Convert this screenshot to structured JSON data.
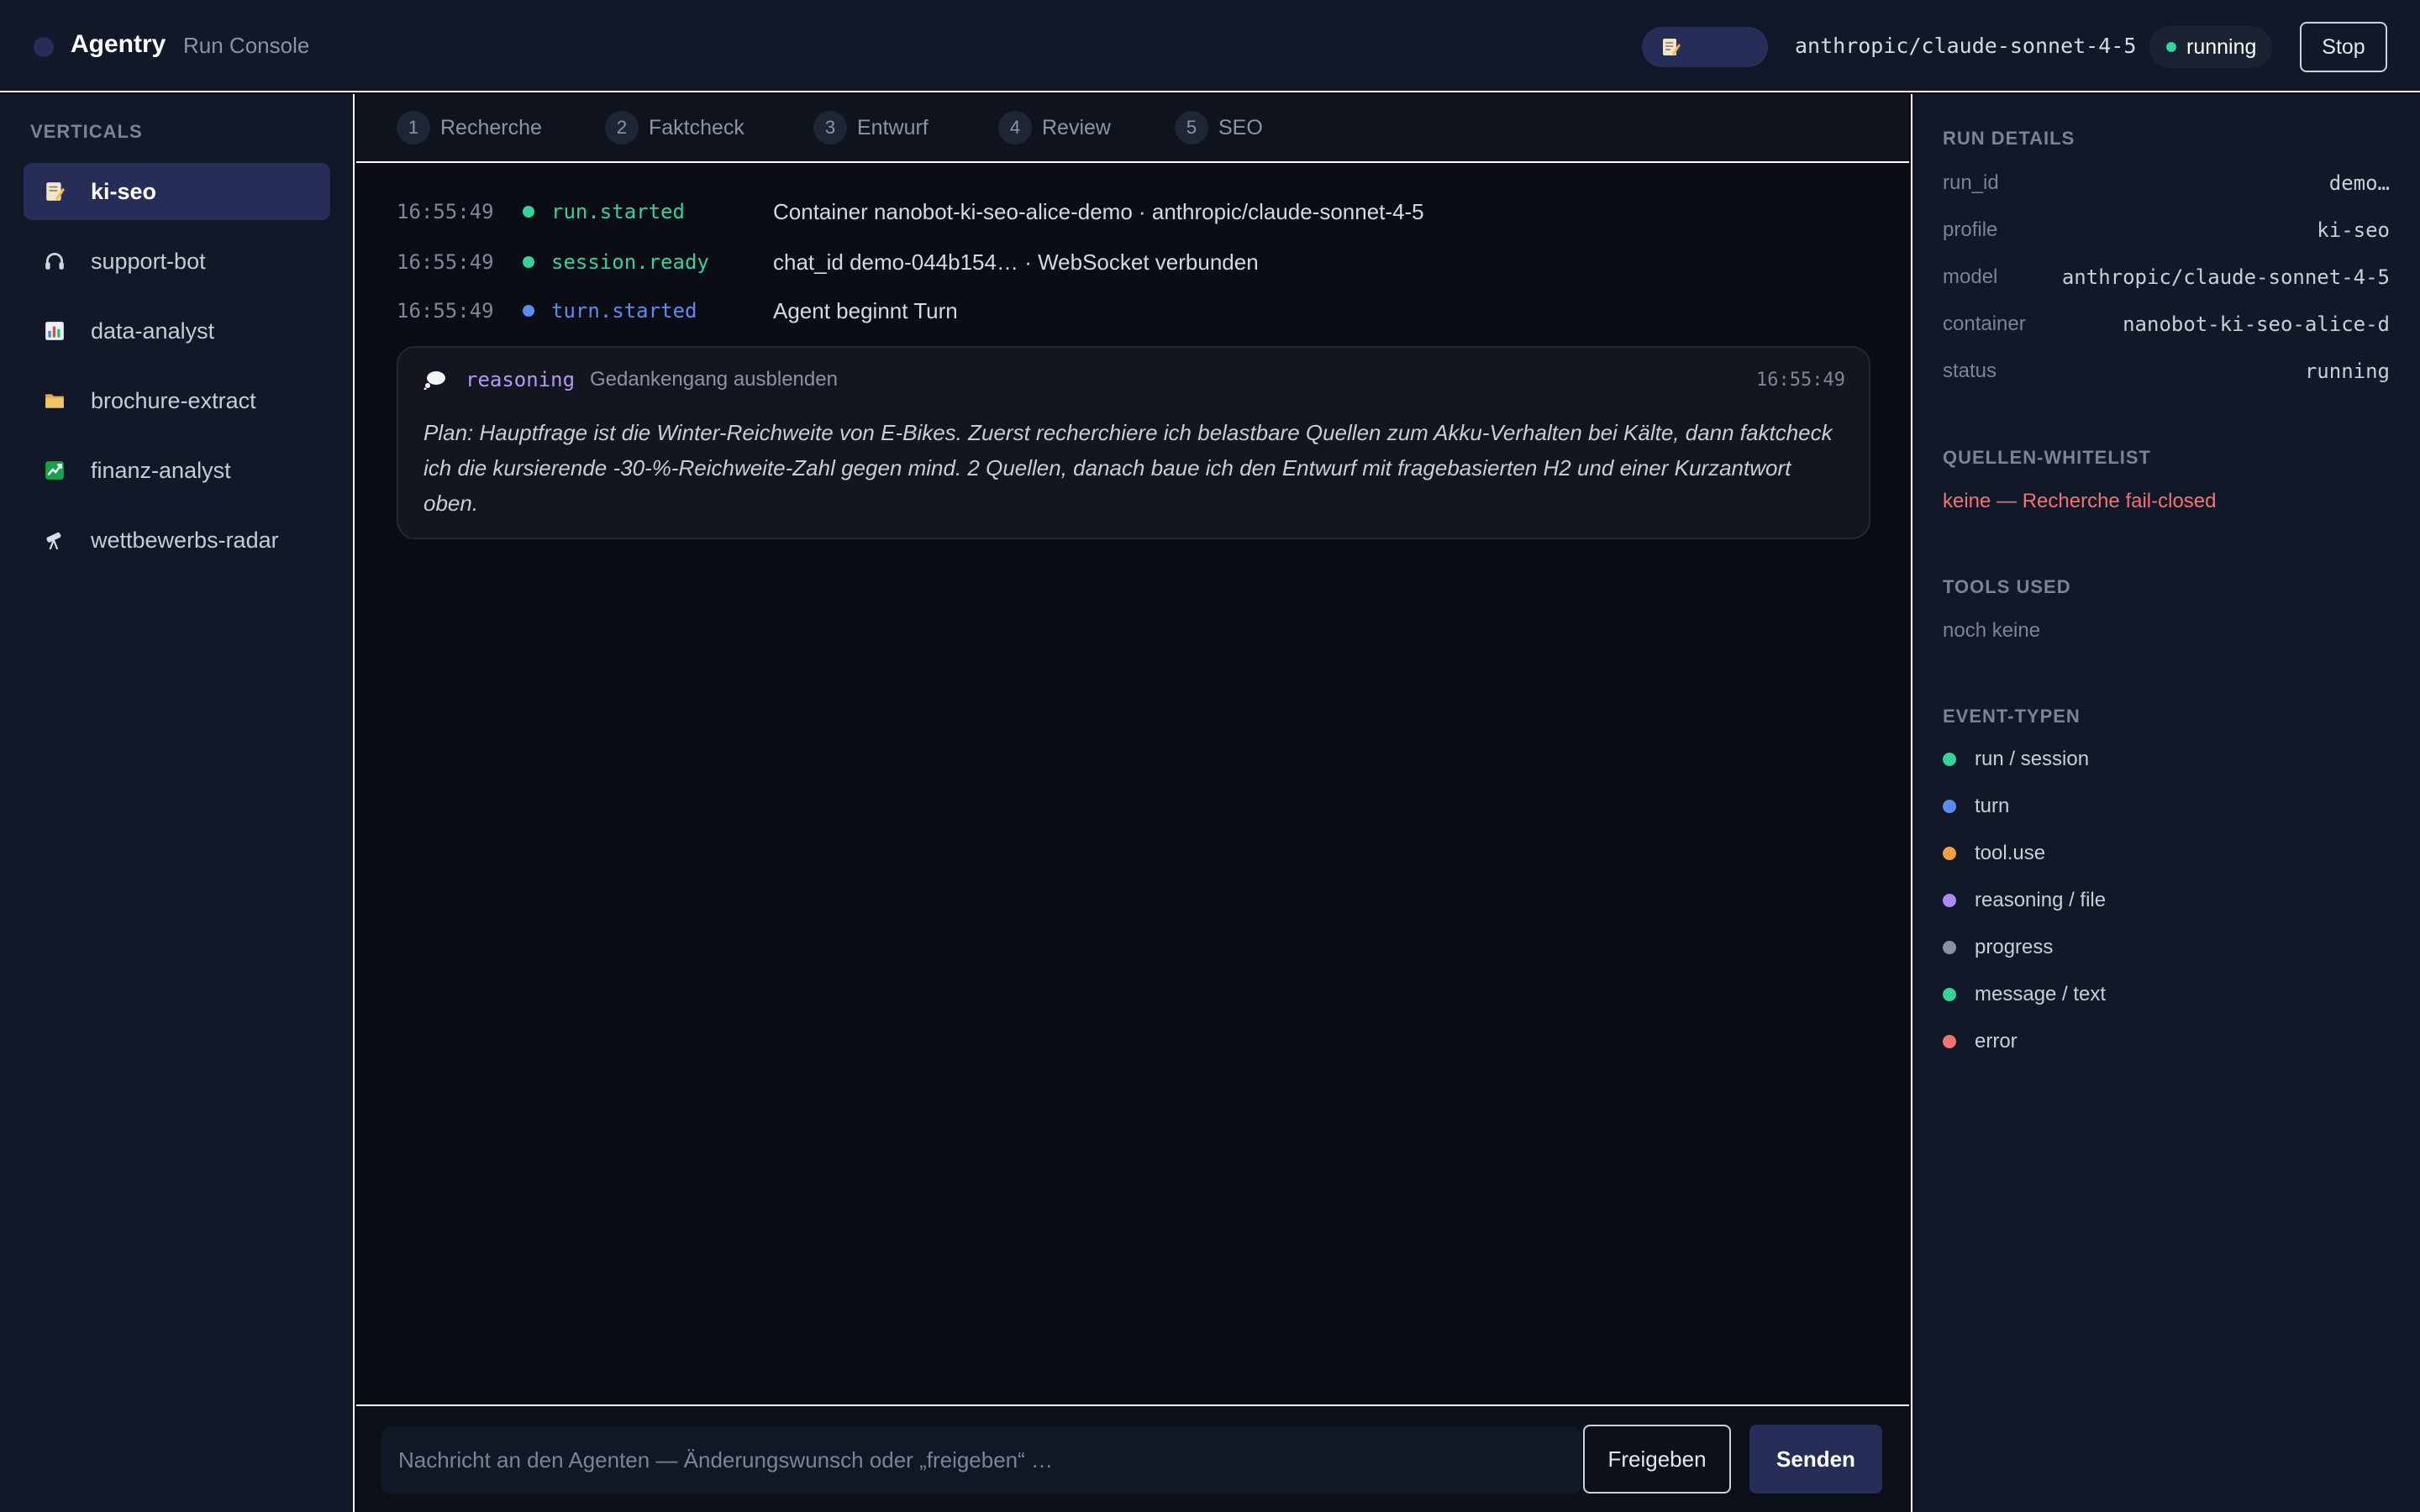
{
  "header": {
    "app_name": "Agentry",
    "subtitle": "Run Console",
    "active_vertical_icon": "memo-icon",
    "model": "anthropic/claude-sonnet-4-5",
    "status": "running",
    "stop_label": "Stop"
  },
  "sidebar": {
    "heading": "VERTICALS",
    "items": [
      {
        "label": "ki-seo",
        "icon": "memo-icon",
        "active": true
      },
      {
        "label": "support-bot",
        "icon": "headphones-icon",
        "active": false
      },
      {
        "label": "data-analyst",
        "icon": "bar-chart-icon",
        "active": false
      },
      {
        "label": "brochure-extract",
        "icon": "folder-icon",
        "active": false
      },
      {
        "label": "finanz-analyst",
        "icon": "chart-increasing-icon",
        "active": false
      },
      {
        "label": "wettbewerbs-radar",
        "icon": "telescope-icon",
        "active": false
      }
    ]
  },
  "steps": [
    {
      "num": "1",
      "label": "Recherche"
    },
    {
      "num": "2",
      "label": "Faktcheck"
    },
    {
      "num": "3",
      "label": "Entwurf"
    },
    {
      "num": "4",
      "label": "Review"
    },
    {
      "num": "5",
      "label": "SEO"
    }
  ],
  "events": [
    {
      "time": "16:55:49",
      "type": "run.started",
      "color": "#34d399",
      "message": "Container nanobot-ki-seo-alice-demo · anthropic/claude-sonnet-4-5"
    },
    {
      "time": "16:55:49",
      "type": "session.ready",
      "color": "#34d399",
      "message": "chat_id demo-044b154… · WebSocket verbunden"
    },
    {
      "time": "16:55:49",
      "type": "turn.started",
      "color": "#5b8def",
      "message": "Agent beginnt Turn"
    }
  ],
  "reasoning": {
    "icon": "thought-bubble-icon",
    "tag": "reasoning",
    "toggle_label": "Gedankengang ausblenden",
    "time": "16:55:49",
    "text": "Plan: Hauptfrage ist die Winter-Reichweite von E-Bikes. Zuerst recherchiere ich belastbare Quellen zum Akku-Verhalten bei Kälte, dann faktcheck ich die kursierende -30-%-Reichweite-Zahl gegen mind. 2 Quellen, danach baue ich den Entwurf mit fragebasierten H2 und einer Kurzantwort oben."
  },
  "composer": {
    "placeholder": "Nachricht an den Agenten — Änderungswunsch oder „freigeben“ …",
    "release_label": "Freigeben",
    "send_label": "Senden"
  },
  "run_details": {
    "heading": "RUN DETAILS",
    "rows": [
      {
        "key": "run_id",
        "value": "demo…"
      },
      {
        "key": "profile",
        "value": "ki-seo"
      },
      {
        "key": "model",
        "value": "anthropic/claude-sonnet-4-5"
      },
      {
        "key": "container",
        "value": "nanobot-ki-seo-alice-d"
      },
      {
        "key": "status",
        "value": "running"
      }
    ]
  },
  "whitelist": {
    "heading": "QUELLEN-WHITELIST",
    "text": "keine — Recherche fail-closed"
  },
  "tools": {
    "heading": "TOOLS USED",
    "text": "noch keine"
  },
  "event_types": {
    "heading": "EVENT-TYPEN",
    "items": [
      {
        "label": "run / session",
        "color": "#34d399"
      },
      {
        "label": "turn",
        "color": "#5b8def"
      },
      {
        "label": "tool.use",
        "color": "#f59e42"
      },
      {
        "label": "reasoning / file",
        "color": "#a78bfa"
      },
      {
        "label": "progress",
        "color": "#8b93a3"
      },
      {
        "label": "message / text",
        "color": "#34d399"
      },
      {
        "label": "error",
        "color": "#f87171"
      }
    ]
  }
}
